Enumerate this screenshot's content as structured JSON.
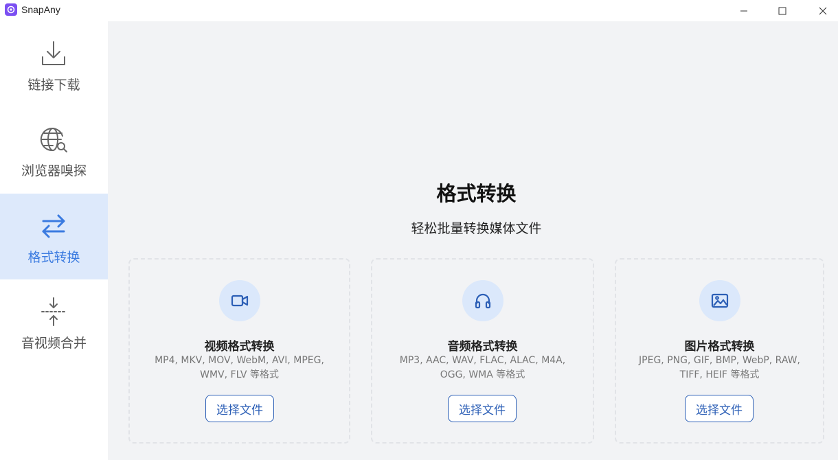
{
  "window": {
    "title": "SnapAny",
    "controls": [
      "minimize",
      "maximize",
      "close"
    ]
  },
  "sidebar": {
    "items": [
      {
        "label": "链接下载",
        "icon": "download-icon",
        "active": false
      },
      {
        "label": "浏览器嗅探",
        "icon": "globe-search-icon",
        "active": false
      },
      {
        "label": "格式转换",
        "icon": "convert-arrows-icon",
        "active": true
      },
      {
        "label": "音视频合并",
        "icon": "merge-icon",
        "active": false
      }
    ]
  },
  "main": {
    "title": "格式转换",
    "subtitle": "轻松批量转换媒体文件",
    "cards": [
      {
        "icon": "video-camera-icon",
        "title": "视频格式转换",
        "desc": "MP4, MKV, MOV, WebM, AVI, MPEG, WMV, FLV 等格式",
        "button": "选择文件"
      },
      {
        "icon": "headphones-icon",
        "title": "音频格式转换",
        "desc": "MP3, AAC, WAV, FLAC, ALAC, M4A, OGG, WMA 等格式",
        "button": "选择文件"
      },
      {
        "icon": "image-icon",
        "title": "图片格式转换",
        "desc": "JPEG, PNG, GIF, BMP, WebP, RAW, TIFF, HEIF 等格式",
        "button": "选择文件"
      }
    ]
  },
  "colors": {
    "accent": "#3b7be0",
    "active_bg": "#dde9fb",
    "main_bg": "#f2f3f5",
    "button_border": "#2c5fb6",
    "logo": "#7b4ff2"
  }
}
